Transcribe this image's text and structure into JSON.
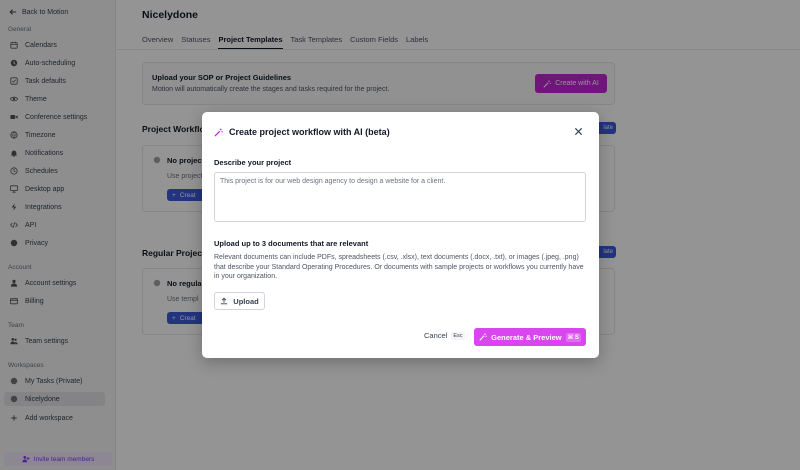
{
  "sidebar": {
    "back": "Back to Motion",
    "sections": {
      "general": "General",
      "account": "Account",
      "team": "Team",
      "workspaces": "Workspaces"
    },
    "general_items": [
      {
        "label": "Calendars",
        "icon": "calendar-icon"
      },
      {
        "label": "Auto-scheduling",
        "icon": "auto-schedule-icon"
      },
      {
        "label": "Task defaults",
        "icon": "checkbox-icon"
      },
      {
        "label": "Theme",
        "icon": "eye-icon"
      },
      {
        "label": "Conference settings",
        "icon": "video-icon"
      },
      {
        "label": "Timezone",
        "icon": "globe-icon"
      },
      {
        "label": "Notifications",
        "icon": "bell-icon"
      },
      {
        "label": "Schedules",
        "icon": "clock-icon"
      },
      {
        "label": "Desktop app",
        "icon": "monitor-icon"
      },
      {
        "label": "Integrations",
        "icon": "bolt-icon"
      },
      {
        "label": "API",
        "icon": "code-icon"
      },
      {
        "label": "Privacy",
        "icon": "shield-icon"
      }
    ],
    "account_items": [
      {
        "label": "Account settings",
        "icon": "user-icon"
      },
      {
        "label": "Billing",
        "icon": "card-icon"
      }
    ],
    "team_items": [
      {
        "label": "Team settings",
        "icon": "team-icon"
      }
    ],
    "workspace_items": [
      {
        "label": "My Tasks (Private)",
        "icon": "workspace-icon"
      },
      {
        "label": "Nicelydone",
        "icon": "workspace-icon"
      },
      {
        "label": "Add workspace",
        "icon": "plus-icon"
      }
    ],
    "invite": "Invite team members"
  },
  "main": {
    "title": "Nicelydone",
    "tabs": [
      "Overview",
      "Statuses",
      "Project Templates",
      "Task Templates",
      "Custom Fields",
      "Labels"
    ],
    "active_tab": "Project Templates",
    "sop": {
      "title": "Upload your SOP or Project Guidelines",
      "desc": "Motion will automatically create the stages and tasks required for the project.",
      "button": "Create with AI"
    },
    "section1": {
      "heading": "Project Workflo",
      "button": "late",
      "card_title": "No project",
      "card_desc": "Use project",
      "card_button": "Creat"
    },
    "section2": {
      "heading": "Regular Project",
      "button": "late",
      "card_title": "No regula",
      "card_desc": "Use templ",
      "card_button": "Creat"
    }
  },
  "modal": {
    "title": "Create project workflow with AI (beta)",
    "describe_label": "Describe your project",
    "describe_placeholder": "This project is for our web design agency to design a website for a client.",
    "upload_label": "Upload up to 3 documents that are relevant",
    "upload_help": "Relevant documents can include PDFs, spreadsheets (.csv, .xlsx), text documents (.docx, .txt), or images (.jpeg, .png) that describe your Standard Operating Procedures. Or documents with sample projects or workflows you currently have in your organization.",
    "upload_button": "Upload",
    "cancel": "Cancel",
    "cancel_shortcut": "Esc",
    "generate": "Generate & Preview",
    "generate_shortcut": "⌘ S"
  },
  "colors": {
    "accent": "#d946ef",
    "primary_blue": "#3b5bdb",
    "sidebar_bg": "#f4f4f5"
  }
}
